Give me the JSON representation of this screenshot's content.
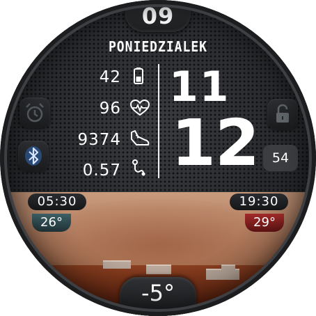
{
  "date": {
    "day": "09",
    "weekday": "PONIEDZIALEK"
  },
  "stats": {
    "battery": {
      "value": "42",
      "icon": "battery-icon"
    },
    "heart_rate": {
      "value": "96",
      "icon": "heart-rate-icon"
    },
    "steps": {
      "value": "9374",
      "icon": "shoe-icon"
    },
    "distance": {
      "value": "0.57",
      "icon": "route-icon"
    }
  },
  "time": {
    "hour": "11",
    "minute": "12",
    "second": "54"
  },
  "side_icons": {
    "alarm": "alarm-icon",
    "bluetooth": "bluetooth-icon",
    "lock": "lock-icon"
  },
  "sun": {
    "sunrise": "05:30",
    "sunset": "19:30"
  },
  "temps": {
    "low": "26°",
    "high": "29°",
    "current": "-5°"
  },
  "colors": {
    "low_temp_accent": "#2f4f55",
    "high_temp_accent": "#8a1f1f",
    "bluetooth_accent": "#3a6fb0",
    "background_dark": "#25272a"
  }
}
